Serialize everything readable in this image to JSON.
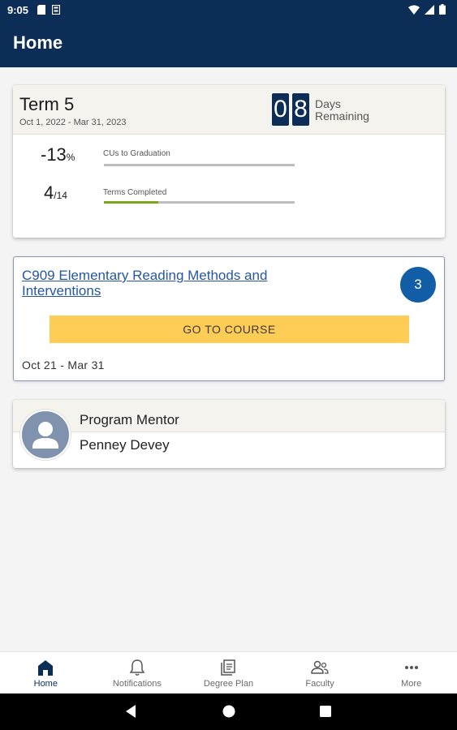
{
  "status_bar": {
    "time": "9:05"
  },
  "app_bar": {
    "title": "Home"
  },
  "term": {
    "name": "Term 5",
    "dates": "Oct 1, 2022 - Mar 31, 2023",
    "days_digits": [
      "0",
      "8"
    ],
    "days_label_line1": "Days",
    "days_label_line2": "Remaining",
    "cus_value": "-13",
    "cus_unit": "%",
    "cus_label": "CUs to Graduation",
    "cus_progress": 0,
    "terms_value": "4",
    "terms_unit": "/14",
    "terms_label": "Terms Completed",
    "terms_progress": 0.2857
  },
  "course": {
    "title": "C909 Elementary Reading Methods and Interventions",
    "badge": "3",
    "button_label": "GO TO COURSE",
    "dates": "Oct 21 - Mar 31"
  },
  "mentor": {
    "role": "Program Mentor",
    "name": "Penney Devey"
  },
  "bottom_nav": [
    {
      "label": "Home",
      "icon": "home-icon",
      "active": true
    },
    {
      "label": "Notifications",
      "icon": "bell-icon",
      "active": false
    },
    {
      "label": "Degree Plan",
      "icon": "degree-plan-icon",
      "active": false
    },
    {
      "label": "Faculty",
      "icon": "faculty-icon",
      "active": false
    },
    {
      "label": "More",
      "icon": "more-icon",
      "active": false
    }
  ],
  "colors": {
    "brand_navy": "#0c2d55",
    "accent_yellow": "#ffcc55",
    "progress_green": "#7fa51b",
    "badge_blue": "#125ea6",
    "link_blue": "#2557a2"
  }
}
